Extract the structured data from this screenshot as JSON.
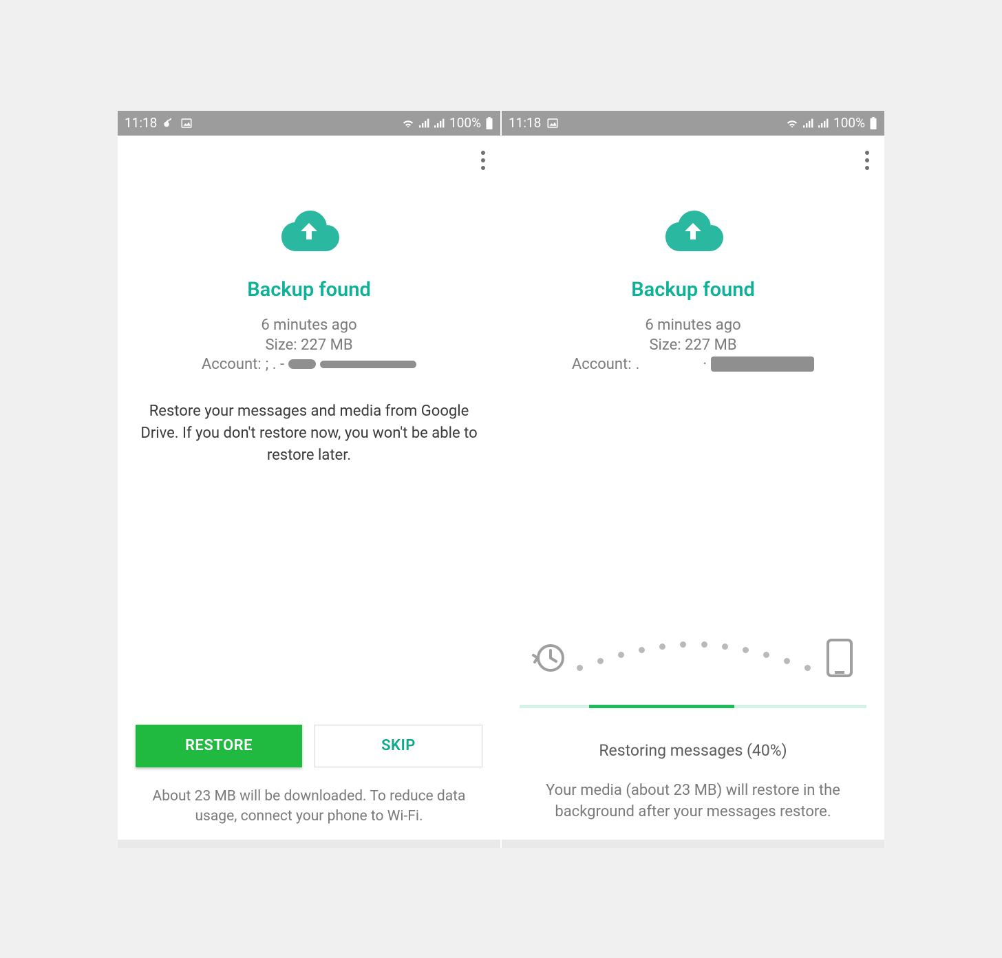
{
  "left": {
    "status": {
      "time": "11:18",
      "battery": "100%"
    },
    "title": "Backup found",
    "timestamp": "6 minutes ago",
    "size_label": "Size: 227 MB",
    "account_label": "Account:",
    "description": "Restore your messages and media from Google Drive. If you don't restore now, you won't be able to restore later.",
    "buttons": {
      "restore": "RESTORE",
      "skip": "SKIP"
    },
    "footer": "About 23 MB will be downloaded. To reduce data usage, connect your phone to Wi-Fi."
  },
  "right": {
    "status": {
      "time": "11:18",
      "battery": "100%"
    },
    "title": "Backup found",
    "timestamp": "6 minutes ago",
    "size_label": "Size: 227 MB",
    "account_label": "Account:",
    "restoring_text": "Restoring messages (40%)",
    "progress_percent": 40,
    "restore_note": "Your media (about 23 MB) will restore in the background after your messages restore."
  },
  "colors": {
    "accent": "#0fb296",
    "primary_button": "#1fba3f",
    "statusbar": "#9c9c9c"
  }
}
